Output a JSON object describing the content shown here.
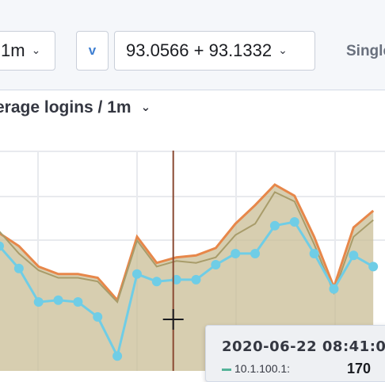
{
  "toolbar": {
    "interval_select": {
      "value": "1m"
    },
    "v_button": {
      "label": "v"
    },
    "range_select": {
      "value": "93.0566 + 93.1332"
    },
    "single_label": "Single"
  },
  "chart": {
    "title": "erage logins / 1m",
    "colors": {
      "area_fill": "#c9be96",
      "orange_line": "#e7874a",
      "blue_line": "#6fcde6",
      "crosshair": "#8a4a32",
      "grid": "#e8eaee"
    }
  },
  "chart_data": {
    "type": "area",
    "grid": true,
    "series": [
      {
        "values": [
          0.75,
          0.63,
          0.54,
          0.5,
          0.5,
          0.48,
          0.37,
          0.7,
          0.56,
          0.59,
          0.58,
          0.61,
          0.73,
          0.79,
          0.96,
          0.91,
          0.68,
          0.42,
          0.72,
          0.81
        ]
      },
      {
        "values": [
          0.74,
          0.67,
          0.56,
          0.52,
          0.52,
          0.5,
          0.38,
          0.72,
          0.58,
          0.61,
          0.62,
          0.66,
          0.79,
          0.89,
          1.0,
          0.94,
          0.72,
          0.45,
          0.77,
          0.86
        ]
      },
      {
        "values": [
          0.67,
          0.55,
          0.37,
          0.38,
          0.37,
          0.29,
          0.08,
          0.52,
          0.48,
          0.49,
          0.49,
          0.57,
          0.63,
          0.63,
          0.78,
          0.8,
          0.63,
          0.44,
          0.62,
          0.56
        ]
      }
    ],
    "crosshair_position": 0.45
  },
  "tooltip": {
    "time": "2020-06-22 08:41:0",
    "row_label": "10.1.100.1:",
    "row_value": "170"
  }
}
